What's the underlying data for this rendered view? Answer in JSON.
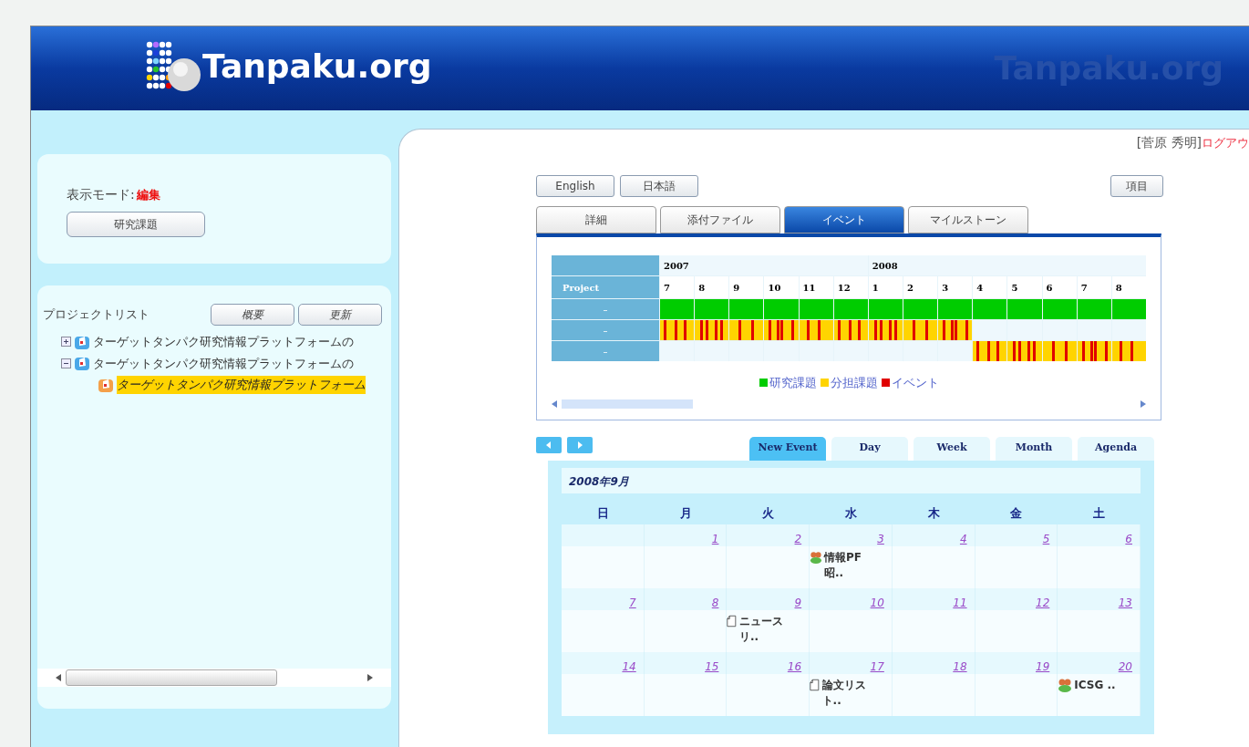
{
  "header": {
    "logo_text": "Tanpaku.org",
    "faded_logo_text": "Tanpaku.org"
  },
  "user": {
    "name": "[菅原 秀明]",
    "logout": "ログアウ"
  },
  "sidebar": {
    "mode_label": "表示モード:",
    "mode_value": "編集",
    "mode_button": "研究課題",
    "project_list_label": "プロジェクトリスト",
    "buttons": [
      "概要",
      "更新"
    ],
    "tree": [
      {
        "label": "ターゲットタンパク研究情報プラットフォームの",
        "expanded": false,
        "selected": false
      },
      {
        "label": "ターゲットタンパク研究情報プラットフォームの",
        "expanded": true,
        "selected": false,
        "children": [
          {
            "label": "ターゲットタンパク研究情報プラットフォーム",
            "selected": true
          }
        ]
      }
    ]
  },
  "language_buttons": [
    "English",
    "日本語"
  ],
  "item_button": "項目",
  "tabs": [
    {
      "label": "詳細",
      "selected": false
    },
    {
      "label": "添付ファイル",
      "selected": false
    },
    {
      "label": "イベント",
      "selected": true
    },
    {
      "label": "マイルストーン",
      "selected": false
    }
  ],
  "gantt": {
    "header_label": "Project",
    "years": [
      "2007",
      "2008"
    ],
    "months": [
      "7",
      "8",
      "9",
      "10",
      "11",
      "12",
      "1",
      "2",
      "3",
      "4",
      "5",
      "6",
      "7",
      "8"
    ],
    "rows": [
      {
        "label": "–",
        "kind": "research",
        "cells": [
          true,
          true,
          true,
          true,
          true,
          true,
          true,
          true,
          true,
          true,
          true,
          true,
          true,
          true
        ]
      },
      {
        "label": "–",
        "kind": "shared",
        "cells": [
          true,
          true,
          true,
          true,
          true,
          true,
          true,
          true,
          true,
          false,
          false,
          false,
          false,
          false
        ]
      },
      {
        "label": "–",
        "kind": "shared",
        "cells": [
          false,
          false,
          false,
          false,
          false,
          false,
          false,
          false,
          false,
          true,
          true,
          true,
          true,
          true
        ]
      }
    ],
    "legend": [
      {
        "label": "研究課題",
        "color": "#00cc00"
      },
      {
        "label": "分担課題",
        "color": "#ffd400"
      },
      {
        "label": "イベント",
        "color": "#e00000"
      }
    ]
  },
  "calendar": {
    "tabs": [
      {
        "label": "New Event",
        "selected": true
      },
      {
        "label": "Day",
        "selected": false
      },
      {
        "label": "Week",
        "selected": false
      },
      {
        "label": "Month",
        "selected": false
      },
      {
        "label": "Agenda",
        "selected": false
      }
    ],
    "title": "2008年9月",
    "weekdays": [
      "日",
      "月",
      "火",
      "水",
      "木",
      "金",
      "土"
    ],
    "weeks": [
      {
        "cells": [
          {
            "kind": "blank"
          },
          {
            "kind": "day",
            "day": "1"
          },
          {
            "kind": "day",
            "day": "2"
          },
          {
            "kind": "day",
            "day": "3",
            "event": {
              "kind": "meeting",
              "text": "情報PF昭.."
            }
          },
          {
            "kind": "day",
            "day": "4"
          },
          {
            "kind": "day",
            "day": "5"
          },
          {
            "kind": "day",
            "day": "6"
          }
        ]
      },
      {
        "cells": [
          {
            "kind": "day",
            "day": "7"
          },
          {
            "kind": "day",
            "day": "8"
          },
          {
            "kind": "day",
            "day": "9",
            "event": {
              "kind": "document",
              "text": "ニュースリ.."
            }
          },
          {
            "kind": "day",
            "day": "10"
          },
          {
            "kind": "day",
            "day": "11"
          },
          {
            "kind": "day",
            "day": "12"
          },
          {
            "kind": "day",
            "day": "13"
          }
        ]
      },
      {
        "cells": [
          {
            "kind": "day",
            "day": "14"
          },
          {
            "kind": "day",
            "day": "15"
          },
          {
            "kind": "day",
            "day": "16"
          },
          {
            "kind": "day",
            "day": "17",
            "event": {
              "kind": "document",
              "text": "論文リスト.."
            }
          },
          {
            "kind": "day",
            "day": "18"
          },
          {
            "kind": "day",
            "day": "19"
          },
          {
            "kind": "day",
            "day": "20",
            "event": {
              "kind": "meeting",
              "text": "ICSG .."
            }
          }
        ]
      }
    ]
  }
}
